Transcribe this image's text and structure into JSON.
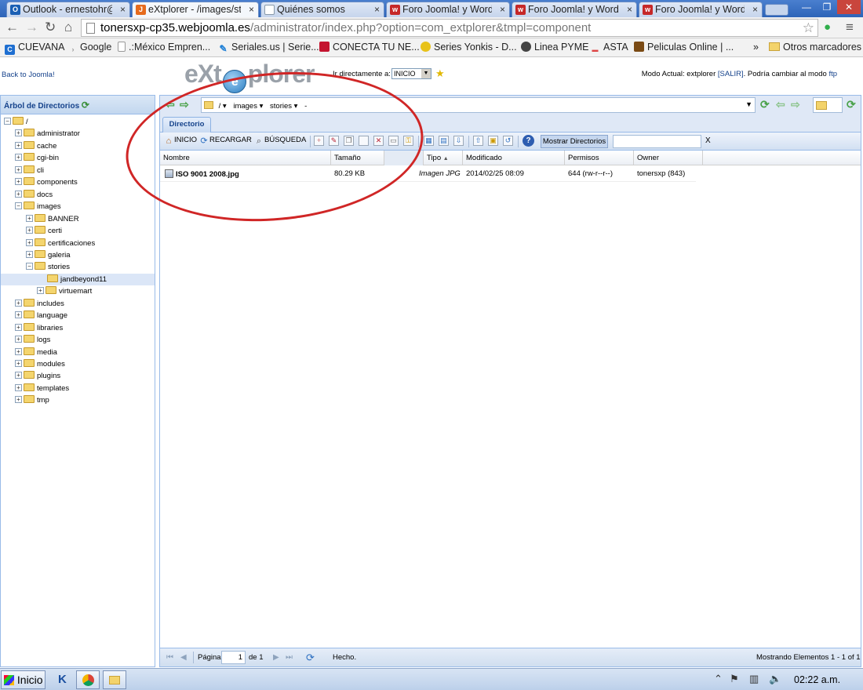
{
  "browser": {
    "tabs": [
      {
        "label": "Outlook - ernestohr@",
        "icon": "outlook-icon",
        "color": "#1a5fb4",
        "glyph": "O"
      },
      {
        "label": "eXtplorer - /images/st",
        "icon": "joomla-icon",
        "color": "#e66b1d",
        "glyph": "J"
      },
      {
        "label": "Quiénes somos",
        "icon": "page-icon",
        "color": "#8899aa",
        "glyph": ""
      },
      {
        "label": "Foro Joomla! y Wordi",
        "icon": "webjoomla-icon",
        "color": "#c62828",
        "glyph": "w"
      },
      {
        "label": "Foro Joomla! y Wordi",
        "icon": "webjoomla-icon",
        "color": "#c62828",
        "glyph": "w"
      },
      {
        "label": "Foro Joomla! y Wordi",
        "icon": "webjoomla-icon",
        "color": "#c62828",
        "glyph": "w"
      }
    ],
    "url_host": "tonersxp-cp35.webjoomla.es",
    "url_path": "/administrator/index.php?option=com_extplorer&tmpl=component",
    "bookmarks": [
      {
        "label": "CUEVANA",
        "icon": "cuevana-icon",
        "color": "#1f6fd1",
        "glyph": "C"
      },
      {
        "label": "Google",
        "icon": "google-icon",
        "color": "#888",
        "glyph": ""
      },
      {
        "label": ".:México Empren...",
        "icon": "page-icon",
        "color": "#999",
        "glyph": ""
      },
      {
        "label": "Seriales.us | Serie...",
        "icon": "pin-icon",
        "color": "#1e7fd6",
        "glyph": ""
      },
      {
        "label": "CONECTA TU NE...",
        "icon": "conecta-icon",
        "color": "#c4142f",
        "glyph": ""
      },
      {
        "label": "Series Yonkis - D...",
        "icon": "yonkis-icon",
        "color": "#e8c21a",
        "glyph": ""
      },
      {
        "label": "Linea PYME",
        "icon": "globe-icon",
        "color": "#444",
        "glyph": ""
      },
      {
        "label": "ASTA",
        "icon": "asta-icon",
        "color": "#d44",
        "glyph": ""
      },
      {
        "label": "Peliculas Online | ...",
        "icon": "film-icon",
        "color": "#7a4a14",
        "glyph": ""
      }
    ],
    "bookmarks_more": "»",
    "other_bookmarks": "Otros marcadores"
  },
  "app": {
    "back_link": "Back to Joomla!",
    "logo_left": "eXt",
    "logo_right": "plorer",
    "goto_label": "Ir directamente a:",
    "goto_value": "INICIO",
    "mode_prefix": "Modo Actual: extplorer",
    "mode_exit": "[SALIR]",
    "mode_middle": ". Podría cambiar al modo",
    "mode_ftp": "ftp"
  },
  "tree": {
    "title": "Árbol de Directorios",
    "root": "/",
    "items": [
      {
        "label": "administrator",
        "depth": 1,
        "expanded": false
      },
      {
        "label": "cache",
        "depth": 1,
        "expanded": false
      },
      {
        "label": "cgi-bin",
        "depth": 1,
        "expanded": false
      },
      {
        "label": "cli",
        "depth": 1,
        "expanded": false
      },
      {
        "label": "components",
        "depth": 1,
        "expanded": false
      },
      {
        "label": "docs",
        "depth": 1,
        "expanded": false
      },
      {
        "label": "images",
        "depth": 1,
        "expanded": true
      },
      {
        "label": "BANNER",
        "depth": 2,
        "expanded": false
      },
      {
        "label": "certi",
        "depth": 2,
        "expanded": false
      },
      {
        "label": "certificaciones",
        "depth": 2,
        "expanded": false
      },
      {
        "label": "galeria",
        "depth": 2,
        "expanded": false
      },
      {
        "label": "stories",
        "depth": 2,
        "expanded": true
      },
      {
        "label": "jandbeyond11",
        "depth": 3,
        "leaf": true,
        "selected": true
      },
      {
        "label": "virtuemart",
        "depth": 3,
        "expanded": false
      },
      {
        "label": "includes",
        "depth": 1,
        "expanded": false
      },
      {
        "label": "language",
        "depth": 1,
        "expanded": false
      },
      {
        "label": "libraries",
        "depth": 1,
        "expanded": false
      },
      {
        "label": "logs",
        "depth": 1,
        "expanded": false
      },
      {
        "label": "media",
        "depth": 1,
        "expanded": false
      },
      {
        "label": "modules",
        "depth": 1,
        "expanded": false
      },
      {
        "label": "plugins",
        "depth": 1,
        "expanded": false
      },
      {
        "label": "templates",
        "depth": 1,
        "expanded": false
      },
      {
        "label": "tmp",
        "depth": 1,
        "expanded": false
      }
    ]
  },
  "path": {
    "root": "/",
    "crumbs": [
      "images",
      "stories"
    ],
    "trail": "-"
  },
  "tab_directory": "Directorio",
  "actions": {
    "home": "INICIO",
    "reload": "RECARGAR",
    "search": "BÚSQUEDA",
    "show_dirs": "Mostrar Directorios",
    "search_clear": "X",
    "search_placeholder": ""
  },
  "grid": {
    "columns": [
      "Nombre",
      "Tamaño",
      "Tipo",
      "Modificado",
      "Permisos",
      "Owner"
    ],
    "sort_indicator": "▲",
    "rows": [
      {
        "name": "ISO 9001 2008.jpg",
        "size": "80.29 KB",
        "type": "Imagen JPG",
        "modified": "2014/02/25 08:09",
        "perms": "644 (rw-r--r--)",
        "owner": "tonersxp (843)"
      }
    ]
  },
  "status": {
    "page_label": "Página",
    "page_value": "1",
    "of_label": "de 1",
    "done": "Hecho.",
    "summary": "Mostrando Elementos 1 - 1 of 1"
  },
  "taskbar": {
    "start": "Inicio",
    "time": "02:22 a.m."
  },
  "colors": {
    "accent": "#15428b",
    "annotation": "#d02626"
  }
}
